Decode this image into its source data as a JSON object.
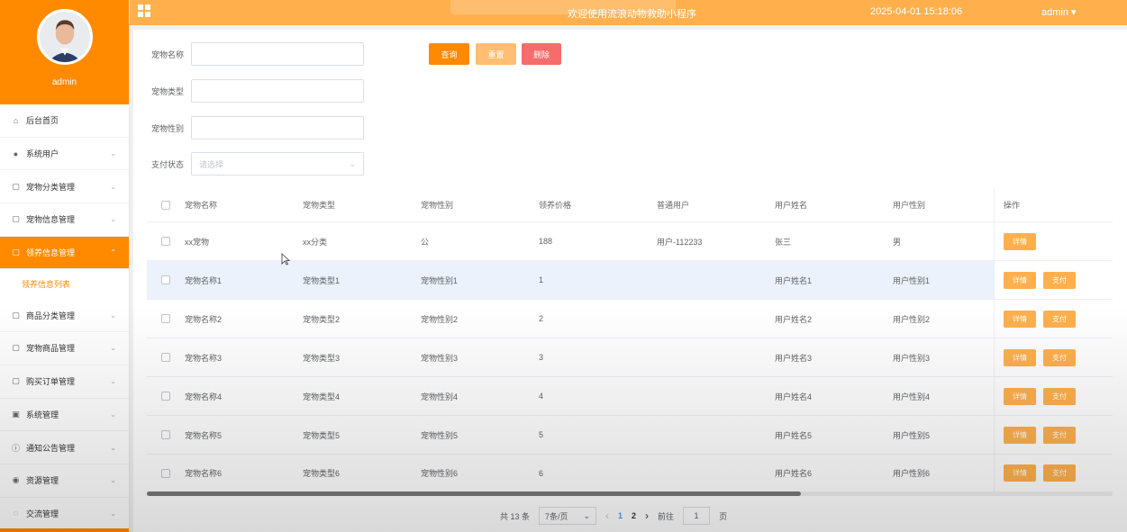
{
  "header": {
    "title": "欢迎使用流浪动物救助小程序",
    "datetime": "2025-04-01 15:18:06",
    "user": "admin ▾"
  },
  "sidebar": {
    "username": "admin",
    "items": [
      {
        "label": "后台首页",
        "icon": "home-icon",
        "arrow": ""
      },
      {
        "label": "系统用户",
        "icon": "user-icon",
        "arrow": "⌄"
      },
      {
        "label": "宠物分类管理",
        "icon": "folder-icon",
        "arrow": "⌄"
      },
      {
        "label": "宠物信息管理",
        "icon": "folder-icon",
        "arrow": "⌄"
      },
      {
        "label": "领养信息管理",
        "icon": "folder-icon",
        "arrow": "⌃"
      },
      {
        "label": "商品分类管理",
        "icon": "folder-icon",
        "arrow": "⌄"
      },
      {
        "label": "宠物商品管理",
        "icon": "folder-icon",
        "arrow": "⌄"
      },
      {
        "label": "购买订单管理",
        "icon": "folder-icon",
        "arrow": "⌄"
      },
      {
        "label": "系统管理",
        "icon": "image-icon",
        "arrow": "⌄"
      },
      {
        "label": "通知公告管理",
        "icon": "info-icon",
        "arrow": "⌄"
      },
      {
        "label": "资源管理",
        "icon": "pin-icon",
        "arrow": "⌄"
      },
      {
        "label": "交流管理",
        "icon": "chat-icon",
        "arrow": "⌄"
      }
    ],
    "submenu_label": "领养信息列表"
  },
  "search": {
    "pet_name_label": "宠物名称",
    "pet_type_label": "宠物类型",
    "pet_gender_label": "宠物性别",
    "pay_status_label": "支付状态",
    "pay_status_placeholder": "请选择",
    "query_label": "查询",
    "reset_label": "重置",
    "delete_label": "删除"
  },
  "table": {
    "headers": [
      "宠物名称",
      "宠物类型",
      "宠物性别",
      "领养价格",
      "普通用户",
      "用户姓名",
      "用户性别",
      "操作"
    ],
    "detail_label": "详情",
    "pay_label": "支付",
    "rows": [
      [
        "xx宠物",
        "xx分类",
        "公",
        "188",
        "用户-112233",
        "张三",
        "男"
      ],
      [
        "宠物名称1",
        "宠物类型1",
        "宠物性别1",
        "1",
        "",
        "用户姓名1",
        "用户性别1"
      ],
      [
        "宠物名称2",
        "宠物类型2",
        "宠物性别2",
        "2",
        "",
        "用户姓名2",
        "用户性别2"
      ],
      [
        "宠物名称3",
        "宠物类型3",
        "宠物性别3",
        "3",
        "",
        "用户姓名3",
        "用户性别3"
      ],
      [
        "宠物名称4",
        "宠物类型4",
        "宠物性别4",
        "4",
        "",
        "用户姓名4",
        "用户性别4"
      ],
      [
        "宠物名称5",
        "宠物类型5",
        "宠物性别5",
        "5",
        "",
        "用户姓名5",
        "用户性别5"
      ],
      [
        "宠物名称6",
        "宠物类型6",
        "宠物性别6",
        "6",
        "",
        "用户姓名6",
        "用户性别6"
      ]
    ]
  },
  "pagination": {
    "total": "共 13 条",
    "page_size": "7条/页",
    "prev": "‹",
    "page1": "1",
    "page2": "2",
    "next": "›",
    "goto_label": "前往",
    "goto_value": "1",
    "page_suffix": "页"
  },
  "colors": {
    "primary": "#ff8a00",
    "header": "#ffb04d",
    "danger": "#f56c6c"
  }
}
